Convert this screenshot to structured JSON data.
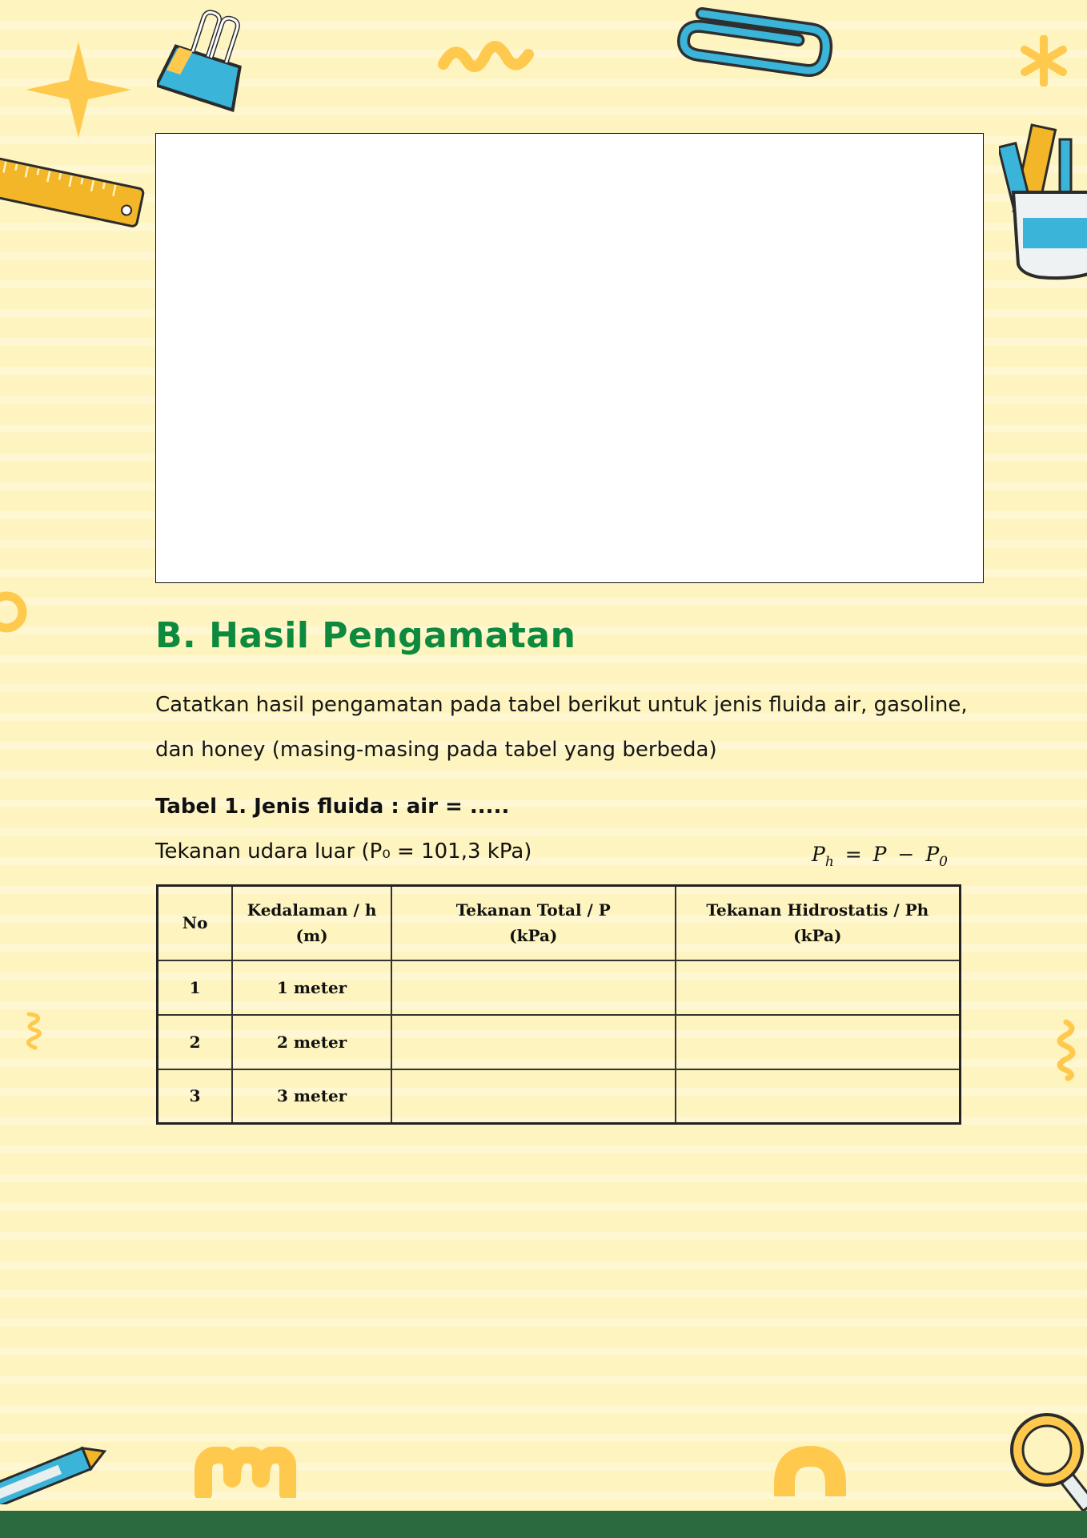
{
  "section": {
    "title": "B.  Hasil Pengamatan",
    "description": "Catatkan hasil pengamatan pada tabel berikut untuk jenis fluida air, gasoline, dan honey (masing-masing pada tabel yang berbeda)"
  },
  "table": {
    "title": "Tabel 1. Jenis fluida : air = .....",
    "pressure_note": "Tekanan udara luar (P₀ = 101,3 kPa)",
    "formula": {
      "lhs": "P",
      "lhs_sub": "h",
      "equals": "=",
      "p": "P",
      "minus": "−",
      "rhs": "P",
      "rhs_sub": "0"
    },
    "headers": [
      {
        "line1": "No",
        "line2": ""
      },
      {
        "line1": "Kedalaman / h",
        "line2": "(m)"
      },
      {
        "line1": "Tekanan Total / P",
        "line2": "(kPa)"
      },
      {
        "line1": "Tekanan Hidrostatis / Ph",
        "line2": "(kPa)"
      }
    ],
    "rows": [
      {
        "no": "1",
        "depth": "1 meter",
        "total": "",
        "hydro": ""
      },
      {
        "no": "2",
        "depth": "2 meter",
        "total": "",
        "hydro": ""
      },
      {
        "no": "3",
        "depth": "3 meter",
        "total": "",
        "hydro": ""
      }
    ]
  },
  "colors": {
    "background": "#fdf4bf",
    "title_green": "#0d8a3e",
    "footer_green": "#2b6a3f",
    "accent_yellow": "#ffc94d",
    "accent_blue": "#3bb4d9"
  },
  "decorations": [
    "star-icon",
    "binder-clip-icon",
    "squiggle-icon",
    "paperclip-icon",
    "asterisk-icon",
    "ruler-icon",
    "pencil-cup-icon",
    "ring-icon",
    "spiral-icon",
    "pencil-icon",
    "wave-icon",
    "arch-icon",
    "magnifier-icon"
  ]
}
